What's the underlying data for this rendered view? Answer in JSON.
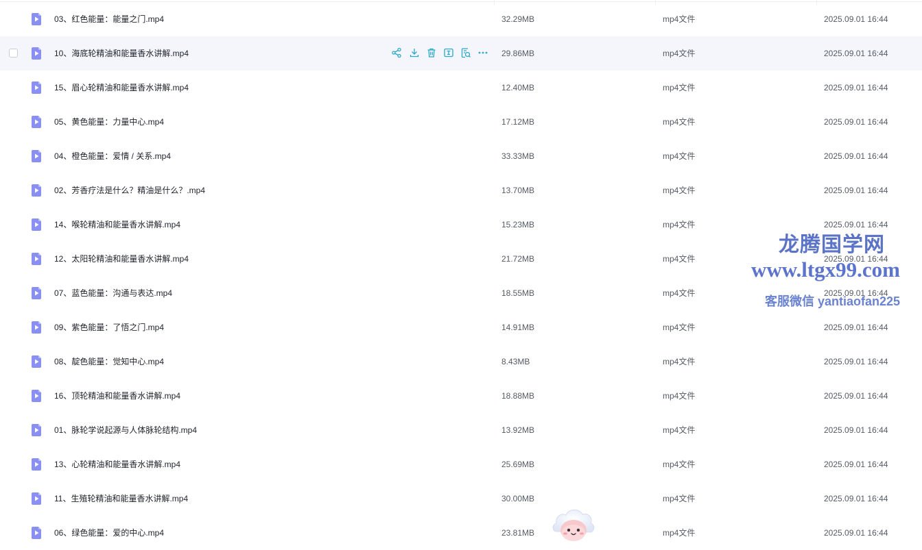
{
  "file_list": {
    "rows": [
      {
        "name": "03、红色能量：能量之门.mp4",
        "size": "32.29MB",
        "type": "mp4文件",
        "date": "2025.09.01 16:44"
      },
      {
        "name": "10、海底轮精油和能量香水讲解.mp4",
        "size": "29.86MB",
        "type": "mp4文件",
        "date": "2025.09.01 16:44"
      },
      {
        "name": "15、眉心轮精油和能量香水讲解.mp4",
        "size": "12.40MB",
        "type": "mp4文件",
        "date": "2025.09.01 16:44"
      },
      {
        "name": "05、黄色能量：力量中心.mp4",
        "size": "17.12MB",
        "type": "mp4文件",
        "date": "2025.09.01 16:44"
      },
      {
        "name": "04、橙色能量：爱情 / 关系.mp4",
        "size": "33.33MB",
        "type": "mp4文件",
        "date": "2025.09.01 16:44"
      },
      {
        "name": "02、芳香疗法是什么？精油是什么？.mp4",
        "size": "13.70MB",
        "type": "mp4文件",
        "date": "2025.09.01 16:44"
      },
      {
        "name": "14、喉轮精油和能量香水讲解.mp4",
        "size": "15.23MB",
        "type": "mp4文件",
        "date": "2025.09.01 16:44"
      },
      {
        "name": "12、太阳轮精油和能量香水讲解.mp4",
        "size": "21.72MB",
        "type": "mp4文件",
        "date": "2025.09.01 16:44"
      },
      {
        "name": "07、蓝色能量：沟通与表达.mp4",
        "size": "18.55MB",
        "type": "mp4文件",
        "date": "2025.09.01 16:44"
      },
      {
        "name": "09、紫色能量：了悟之门.mp4",
        "size": "14.91MB",
        "type": "mp4文件",
        "date": "2025.09.01 16:44"
      },
      {
        "name": "08、靛色能量：觉知中心.mp4",
        "size": "8.43MB",
        "type": "mp4文件",
        "date": "2025.09.01 16:44"
      },
      {
        "name": "16、顶轮精油和能量香水讲解.mp4",
        "size": "18.88MB",
        "type": "mp4文件",
        "date": "2025.09.01 16:44"
      },
      {
        "name": "01、脉轮学说起源与人体脉轮结构.mp4",
        "size": "13.92MB",
        "type": "mp4文件",
        "date": "2025.09.01 16:44"
      },
      {
        "name": "13、心轮精油和能量香水讲解.mp4",
        "size": "25.69MB",
        "type": "mp4文件",
        "date": "2025.09.01 16:44"
      },
      {
        "name": "11、生殖轮精油和能量香水讲解.mp4",
        "size": "30.00MB",
        "type": "mp4文件",
        "date": "2025.09.01 16:44"
      },
      {
        "name": "06、绿色能量：爱的中心.mp4",
        "size": "23.81MB",
        "type": "mp4文件",
        "date": "2025.09.01 16:44"
      }
    ],
    "hovered_row_index": 1,
    "row_actions": [
      "share-icon",
      "download-icon",
      "delete-icon",
      "rename-icon",
      "copy-icon",
      "more-icon"
    ]
  },
  "watermark": {
    "title": "龙腾国学网",
    "url": "www.ltgx99.com",
    "contact": "客服微信 yantiaofan225"
  },
  "colors": {
    "video_icon": "#7b83f0",
    "action_icon": "#2aa8c8",
    "hover_row": "#f4f6fb",
    "watermark": "#5d74cd"
  }
}
